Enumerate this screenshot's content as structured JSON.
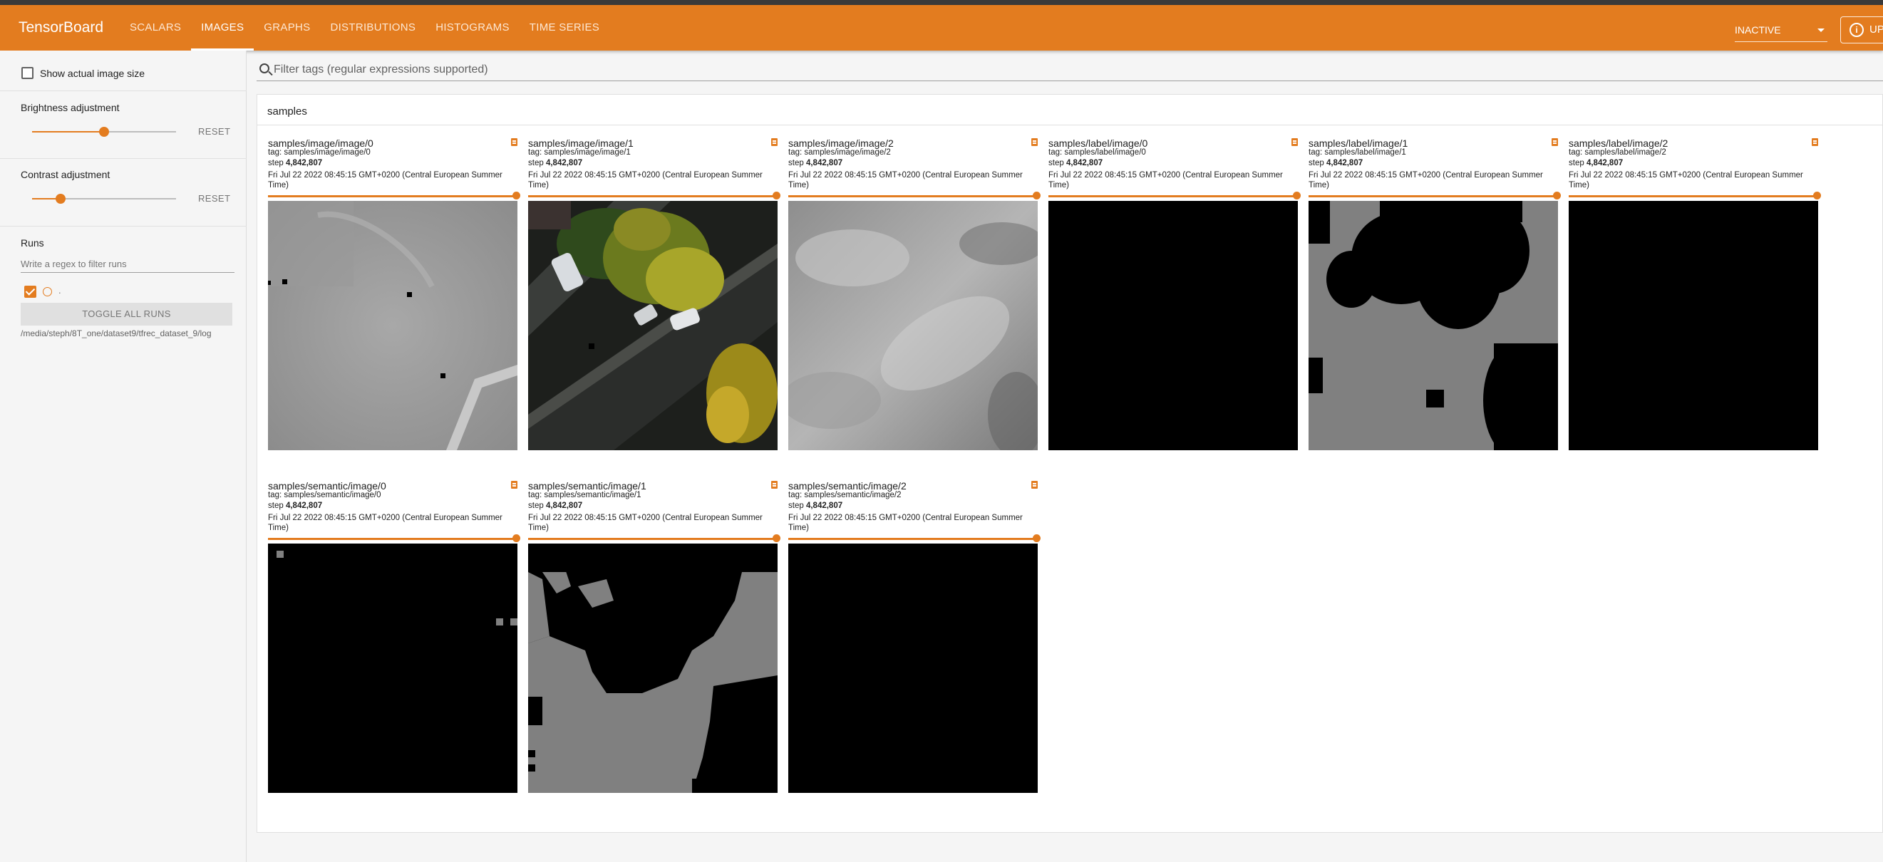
{
  "app": {
    "brand": "TensorBoard",
    "tabs": [
      {
        "label": "SCALARS",
        "active": false
      },
      {
        "label": "IMAGES",
        "active": true
      },
      {
        "label": "GRAPHS",
        "active": false
      },
      {
        "label": "DISTRIBUTIONS",
        "active": false
      },
      {
        "label": "HISTOGRAMS",
        "active": false
      },
      {
        "label": "TIME SERIES",
        "active": false
      }
    ],
    "status_select": "INACTIVE",
    "update_button": "UP",
    "accent_color": "#e37c1f"
  },
  "sidebar": {
    "show_actual_size_label": "Show actual image size",
    "show_actual_size_checked": false,
    "brightness": {
      "label": "Brightness adjustment",
      "reset_label": "RESET",
      "value_fraction": 0.5
    },
    "contrast": {
      "label": "Contrast adjustment",
      "reset_label": "RESET",
      "value_fraction": 0.2
    },
    "runs": {
      "title": "Runs",
      "filter_placeholder": "Write a regex to filter runs",
      "run_label": ".",
      "run_checked": true,
      "toggle_all_label": "TOGGLE ALL RUNS",
      "log_path": "/media/steph/8T_one/dataset9/tfrec_dataset_9/log"
    }
  },
  "main": {
    "filter_placeholder": "Filter tags (regular expressions supported)",
    "group_title": "samples",
    "cards": [
      {
        "title": "samples/image/image/0",
        "tag": "tag: samples/image/image/0",
        "step_label": "step",
        "step": "4,842,807",
        "time": "Fri Jul 22 2022 08:45:15 GMT+0200 (Central European Summer Time)",
        "image": "gray-ground"
      },
      {
        "title": "samples/image/image/1",
        "tag": "tag: samples/image/image/1",
        "step_label": "step",
        "step": "4,842,807",
        "time": "Fri Jul 22 2022 08:45:15 GMT+0200 (Central European Summer Time)",
        "image": "aerial-street"
      },
      {
        "title": "samples/image/image/2",
        "tag": "tag: samples/image/image/2",
        "step_label": "step",
        "step": "4,842,807",
        "time": "Fri Jul 22 2022 08:45:15 GMT+0200 (Central European Summer Time)",
        "image": "gray-texture"
      },
      {
        "title": "samples/label/image/0",
        "tag": "tag: samples/label/image/0",
        "step_label": "step",
        "step": "4,842,807",
        "time": "Fri Jul 22 2022 08:45:15 GMT+0200 (Central European Summer Time)",
        "image": "black"
      },
      {
        "title": "samples/label/image/1",
        "tag": "tag: samples/label/image/1",
        "step_label": "step",
        "step": "4,842,807",
        "time": "Fri Jul 22 2022 08:45:15 GMT+0200 (Central European Summer Time)",
        "image": "label-mask"
      },
      {
        "title": "samples/label/image/2",
        "tag": "tag: samples/label/image/2",
        "step_label": "step",
        "step": "4,842,807",
        "time": "Fri Jul 22 2022 08:45:15 GMT+0200 (Central European Summer Time)",
        "image": "black"
      },
      {
        "title": "samples/semantic/image/0",
        "tag": "tag: samples/semantic/image/0",
        "step_label": "step",
        "step": "4,842,807",
        "time": "Fri Jul 22 2022 08:45:15 GMT+0200 (Central European Summer Time)",
        "image": "semantic-black"
      },
      {
        "title": "samples/semantic/image/1",
        "tag": "tag: samples/semantic/image/1",
        "step_label": "step",
        "step": "4,842,807",
        "time": "Fri Jul 22 2022 08:45:15 GMT+0200 (Central European Summer Time)",
        "image": "semantic-mask"
      },
      {
        "title": "samples/semantic/image/2",
        "tag": "tag: samples/semantic/image/2",
        "step_label": "step",
        "step": "4,842,807",
        "time": "Fri Jul 22 2022 08:45:15 GMT+0200 (Central European Summer Time)",
        "image": "black"
      }
    ]
  }
}
